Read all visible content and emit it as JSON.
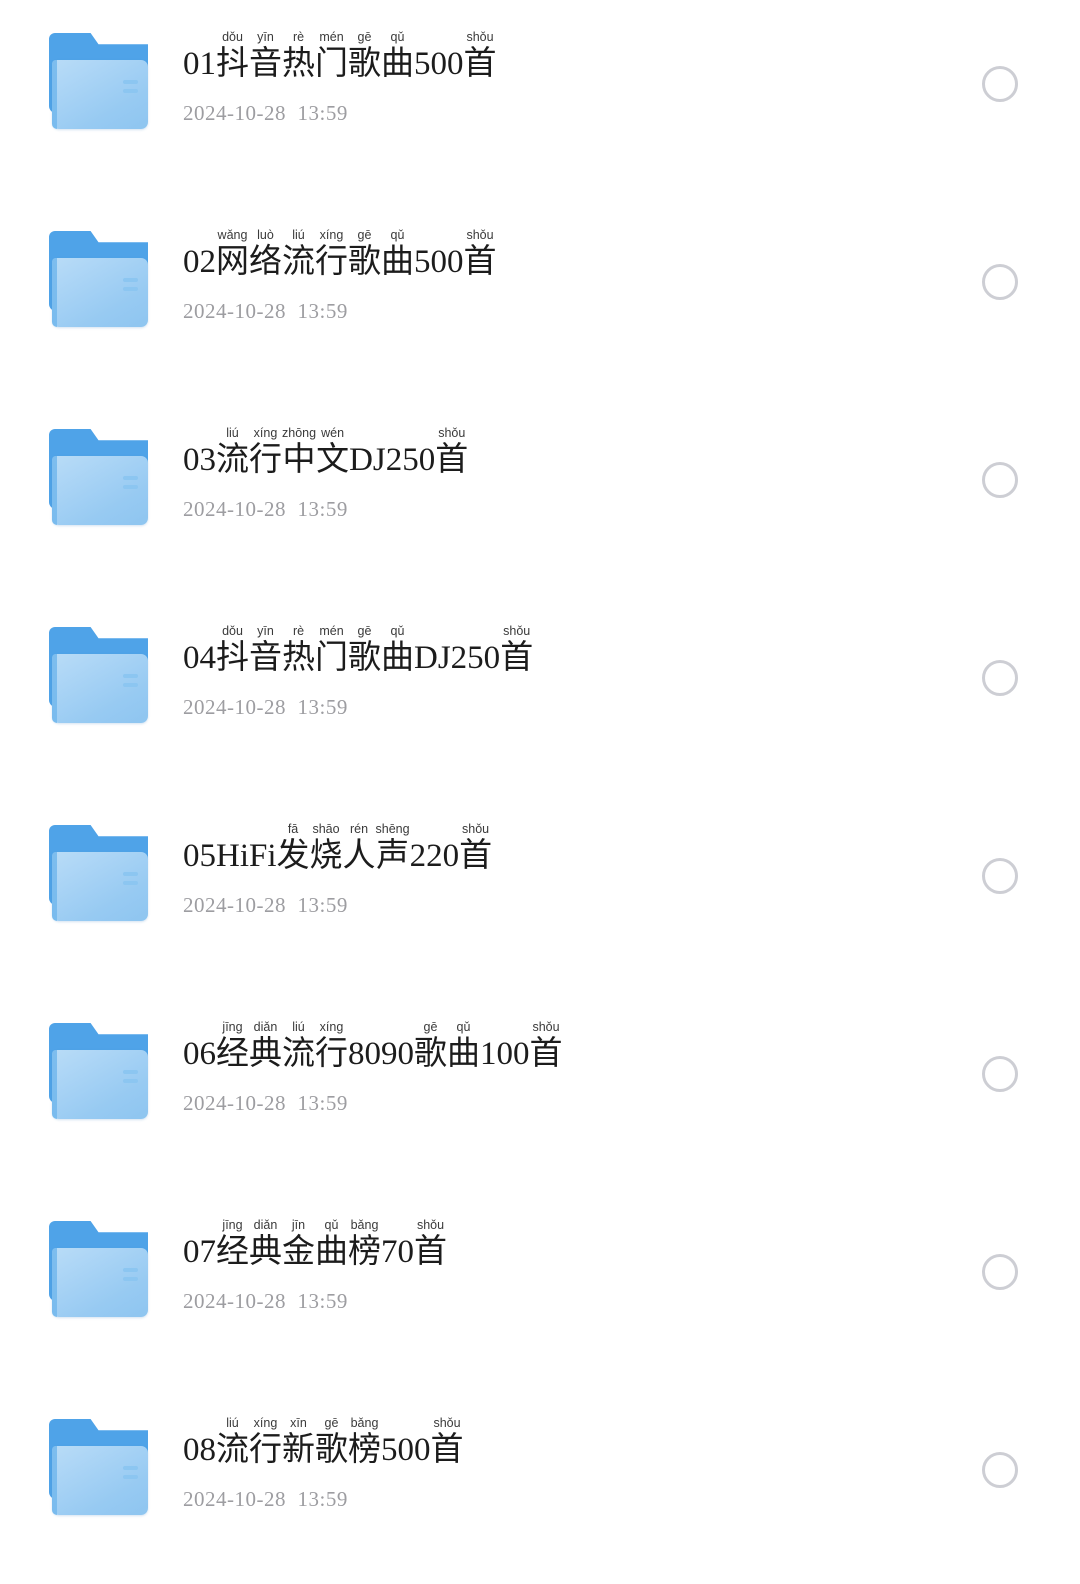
{
  "screen": {
    "background": "#ffffff",
    "accent_folder_tab": "#4fa3e8",
    "accent_folder_body": "#a8d3f5",
    "circle_color": "#cdced4",
    "title_color": "#1c1c1c",
    "date_color": "#9d9da1"
  },
  "list": {
    "items": [
      {
        "index": "01",
        "title": "01抖音热门歌曲500首",
        "date": "2024-10-28  13:59",
        "selected": false,
        "icon": "folder-icon",
        "segments": [
          {
            "pinyin": "",
            "text": "01"
          },
          {
            "pinyin": "dǒu",
            "text": "抖"
          },
          {
            "pinyin": "yīn",
            "text": "音"
          },
          {
            "pinyin": "rè",
            "text": "热"
          },
          {
            "pinyin": "mén",
            "text": "门"
          },
          {
            "pinyin": "gē",
            "text": "歌"
          },
          {
            "pinyin": "qǔ",
            "text": "曲"
          },
          {
            "pinyin": "",
            "text": "500"
          },
          {
            "pinyin": "shǒu",
            "text": "首"
          }
        ]
      },
      {
        "index": "02",
        "title": "02网络流行歌曲500首",
        "date": "2024-10-28  13:59",
        "selected": false,
        "icon": "folder-icon",
        "segments": [
          {
            "pinyin": "",
            "text": "02"
          },
          {
            "pinyin": "wǎng",
            "text": "网"
          },
          {
            "pinyin": "luò",
            "text": "络"
          },
          {
            "pinyin": "liú",
            "text": "流"
          },
          {
            "pinyin": "xíng",
            "text": "行"
          },
          {
            "pinyin": "gē",
            "text": "歌"
          },
          {
            "pinyin": "qǔ",
            "text": "曲"
          },
          {
            "pinyin": "",
            "text": "500"
          },
          {
            "pinyin": "shǒu",
            "text": "首"
          }
        ]
      },
      {
        "index": "03",
        "title": "03流行中文DJ250首",
        "date": "2024-10-28  13:59",
        "selected": false,
        "icon": "folder-icon",
        "segments": [
          {
            "pinyin": "",
            "text": "03"
          },
          {
            "pinyin": "liú",
            "text": "流"
          },
          {
            "pinyin": "xíng",
            "text": "行"
          },
          {
            "pinyin": "zhōng",
            "text": "中"
          },
          {
            "pinyin": "wén",
            "text": "文"
          },
          {
            "pinyin": "",
            "text": "DJ250"
          },
          {
            "pinyin": "shǒu",
            "text": "首"
          }
        ]
      },
      {
        "index": "04",
        "title": "04抖音热门歌曲DJ250首",
        "date": "2024-10-28  13:59",
        "selected": false,
        "icon": "folder-icon",
        "segments": [
          {
            "pinyin": "",
            "text": "04"
          },
          {
            "pinyin": "dǒu",
            "text": "抖"
          },
          {
            "pinyin": "yīn",
            "text": "音"
          },
          {
            "pinyin": "rè",
            "text": "热"
          },
          {
            "pinyin": "mén",
            "text": "门"
          },
          {
            "pinyin": "gē",
            "text": "歌"
          },
          {
            "pinyin": "qǔ",
            "text": "曲"
          },
          {
            "pinyin": "",
            "text": "DJ250"
          },
          {
            "pinyin": "shǒu",
            "text": "首"
          }
        ]
      },
      {
        "index": "05",
        "title": "05HiFi发烧人声220首",
        "date": "2024-10-28  13:59",
        "selected": false,
        "icon": "folder-icon",
        "segments": [
          {
            "pinyin": "",
            "text": "05HiFi"
          },
          {
            "pinyin": "fā",
            "text": "发"
          },
          {
            "pinyin": "shāo",
            "text": "烧"
          },
          {
            "pinyin": "rén",
            "text": "人"
          },
          {
            "pinyin": "shēng",
            "text": "声"
          },
          {
            "pinyin": "",
            "text": "220"
          },
          {
            "pinyin": "shǒu",
            "text": "首"
          }
        ]
      },
      {
        "index": "06",
        "title": "06经典流行8090歌曲100首",
        "date": "2024-10-28  13:59",
        "selected": false,
        "icon": "folder-icon",
        "segments": [
          {
            "pinyin": "",
            "text": "06"
          },
          {
            "pinyin": "jīng",
            "text": "经"
          },
          {
            "pinyin": "diǎn",
            "text": "典"
          },
          {
            "pinyin": "liú",
            "text": "流"
          },
          {
            "pinyin": "xíng",
            "text": "行"
          },
          {
            "pinyin": "",
            "text": "8090"
          },
          {
            "pinyin": "gē",
            "text": "歌"
          },
          {
            "pinyin": "qǔ",
            "text": "曲"
          },
          {
            "pinyin": "",
            "text": "100"
          },
          {
            "pinyin": "shǒu",
            "text": "首"
          }
        ]
      },
      {
        "index": "07",
        "title": "07经典金曲榜70首",
        "date": "2024-10-28  13:59",
        "selected": false,
        "icon": "folder-icon",
        "segments": [
          {
            "pinyin": "",
            "text": "07"
          },
          {
            "pinyin": "jīng",
            "text": "经"
          },
          {
            "pinyin": "diǎn",
            "text": "典"
          },
          {
            "pinyin": "jīn",
            "text": "金"
          },
          {
            "pinyin": "qǔ",
            "text": "曲"
          },
          {
            "pinyin": "bǎng",
            "text": "榜"
          },
          {
            "pinyin": "",
            "text": "70"
          },
          {
            "pinyin": "shǒu",
            "text": "首"
          }
        ]
      },
      {
        "index": "08",
        "title": "08流行新歌榜500首",
        "date": "2024-10-28  13:59",
        "selected": false,
        "icon": "folder-icon",
        "segments": [
          {
            "pinyin": "",
            "text": "08"
          },
          {
            "pinyin": "liú",
            "text": "流"
          },
          {
            "pinyin": "xíng",
            "text": "行"
          },
          {
            "pinyin": "xīn",
            "text": "新"
          },
          {
            "pinyin": "gē",
            "text": "歌"
          },
          {
            "pinyin": "bǎng",
            "text": "榜"
          },
          {
            "pinyin": "",
            "text": "500"
          },
          {
            "pinyin": "shǒu",
            "text": "首"
          }
        ]
      }
    ]
  }
}
